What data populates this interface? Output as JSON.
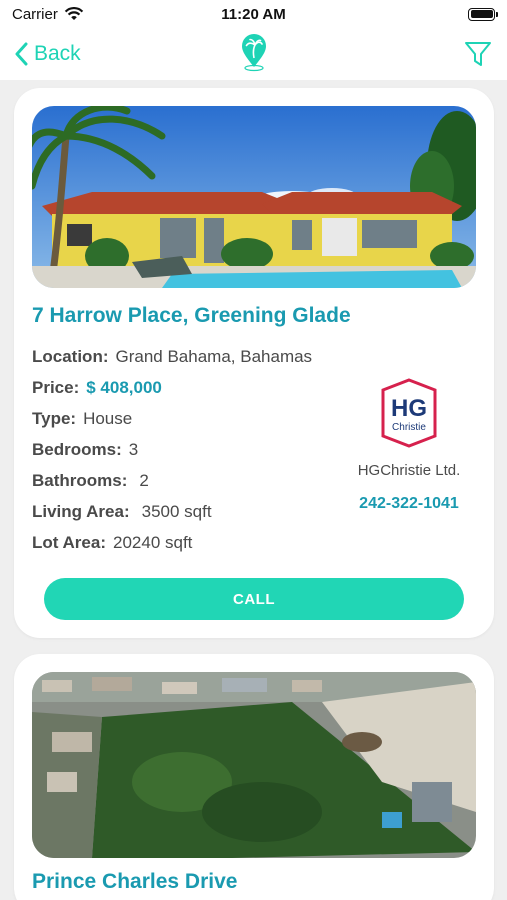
{
  "status_bar": {
    "carrier": "Carrier",
    "time": "11:20 AM"
  },
  "nav": {
    "back_label": "Back"
  },
  "colors": {
    "accent": "#21d6b5",
    "title": "#1a9ab0"
  },
  "listings": [
    {
      "title": "7 Harrow Place, Greening Glade",
      "location_label": "Location:",
      "location": "Grand Bahama, Bahamas",
      "price_label": "Price:",
      "price": "$ 408,000",
      "type_label": "Type:",
      "type": "House",
      "bedrooms_label": "Bedrooms:",
      "bedrooms": "3",
      "bathrooms_label": "Bathrooms:",
      "bathrooms": "2",
      "living_area_label": "Living Area:",
      "living_area": "3500 sqft",
      "lot_area_label": "Lot Area:",
      "lot_area": "20240 sqft",
      "agent": {
        "logo_text_top": "HG",
        "logo_text_bottom": "Christie",
        "name": "HGChristie Ltd.",
        "phone": "242-322-1041"
      },
      "call_label": "CALL"
    },
    {
      "title": "Prince Charles Drive"
    }
  ]
}
